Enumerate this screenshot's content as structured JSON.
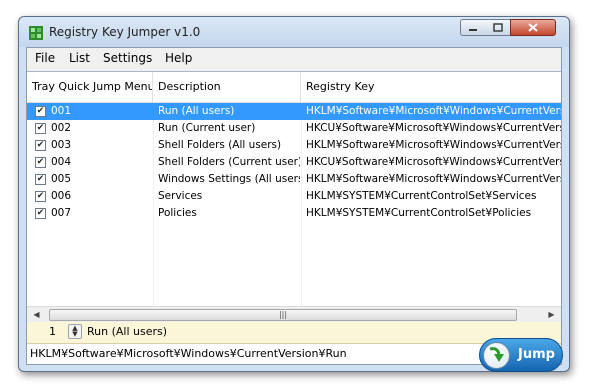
{
  "window": {
    "title": "Registry Key Jumper v1.0"
  },
  "menu": [
    "File",
    "List",
    "Settings",
    "Help"
  ],
  "columns": [
    "Tray Quick Jump Menu",
    "Description",
    "Registry Key"
  ],
  "rows": [
    {
      "id": "001",
      "checked": true,
      "description": "Run (All users)",
      "key": "HKLM¥Software¥Microsoft¥Windows¥CurrentVersion",
      "selected": true
    },
    {
      "id": "002",
      "checked": true,
      "description": "Run (Current user)",
      "key": "HKCU¥Software¥Microsoft¥Windows¥CurrentVersion",
      "selected": false
    },
    {
      "id": "003",
      "checked": true,
      "description": "Shell Folders (All users)",
      "key": "HKLM¥Software¥Microsoft¥Windows¥CurrentVersion",
      "selected": false
    },
    {
      "id": "004",
      "checked": true,
      "description": "Shell Folders (Current user)",
      "key": "HKCU¥Software¥Microsoft¥Windows¥CurrentVersion",
      "selected": false
    },
    {
      "id": "005",
      "checked": true,
      "description": "Windows Settings (All users)",
      "key": "HKLM¥Software¥Microsoft¥Windows¥CurrentVersion",
      "selected": false
    },
    {
      "id": "006",
      "checked": true,
      "description": "Services",
      "key": "HKLM¥SYSTEM¥CurrentControlSet¥Services",
      "selected": false
    },
    {
      "id": "007",
      "checked": true,
      "description": "Policies",
      "key": "HKLM¥SYSTEM¥CurrentControlSet¥Policies",
      "selected": false
    }
  ],
  "navigator": {
    "number": "1",
    "description": "Run (All users)"
  },
  "status": {
    "path": "HKLM¥Software¥Microsoft¥Windows¥CurrentVersion¥Run"
  },
  "jump_label": "Jump",
  "colors": {
    "selection": "#3399ff",
    "navigator_bg": "#fbf6d8",
    "jump_button": "#1f7fd0"
  }
}
